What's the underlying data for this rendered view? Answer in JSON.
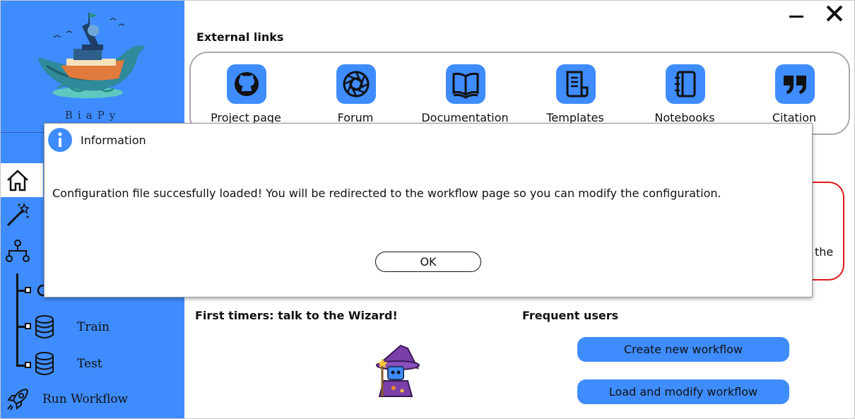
{
  "sidebar": {
    "app_name": "BiaPy",
    "nav": {
      "train_label": "Train",
      "test_label": "Test",
      "run_label": "Run Workflow"
    }
  },
  "main": {
    "external_links_title": "External links",
    "links": [
      {
        "label": "Project page",
        "icon": "github-icon"
      },
      {
        "label": "Forum",
        "icon": "forum-icon"
      },
      {
        "label": "Documentation",
        "icon": "book-icon"
      },
      {
        "label": "Templates",
        "icon": "scroll-icon"
      },
      {
        "label": "Notebooks",
        "icon": "notebook-icon"
      },
      {
        "label": "Citation",
        "icon": "quote-icon"
      }
    ],
    "partial_text": "the",
    "first_timers_title": "First timers: talk to the Wizard!",
    "frequent_users_title": "Frequent users",
    "create_workflow_label": "Create new workflow",
    "load_workflow_label": "Load and modify workflow"
  },
  "dialog": {
    "title": "Information",
    "message": "Configuration file succesfully loaded! You will be redirected to the workflow page so you can modify the configuration.",
    "ok_label": "OK"
  },
  "colors": {
    "accent": "#3f8cff",
    "alert_border": "#e0191e"
  }
}
